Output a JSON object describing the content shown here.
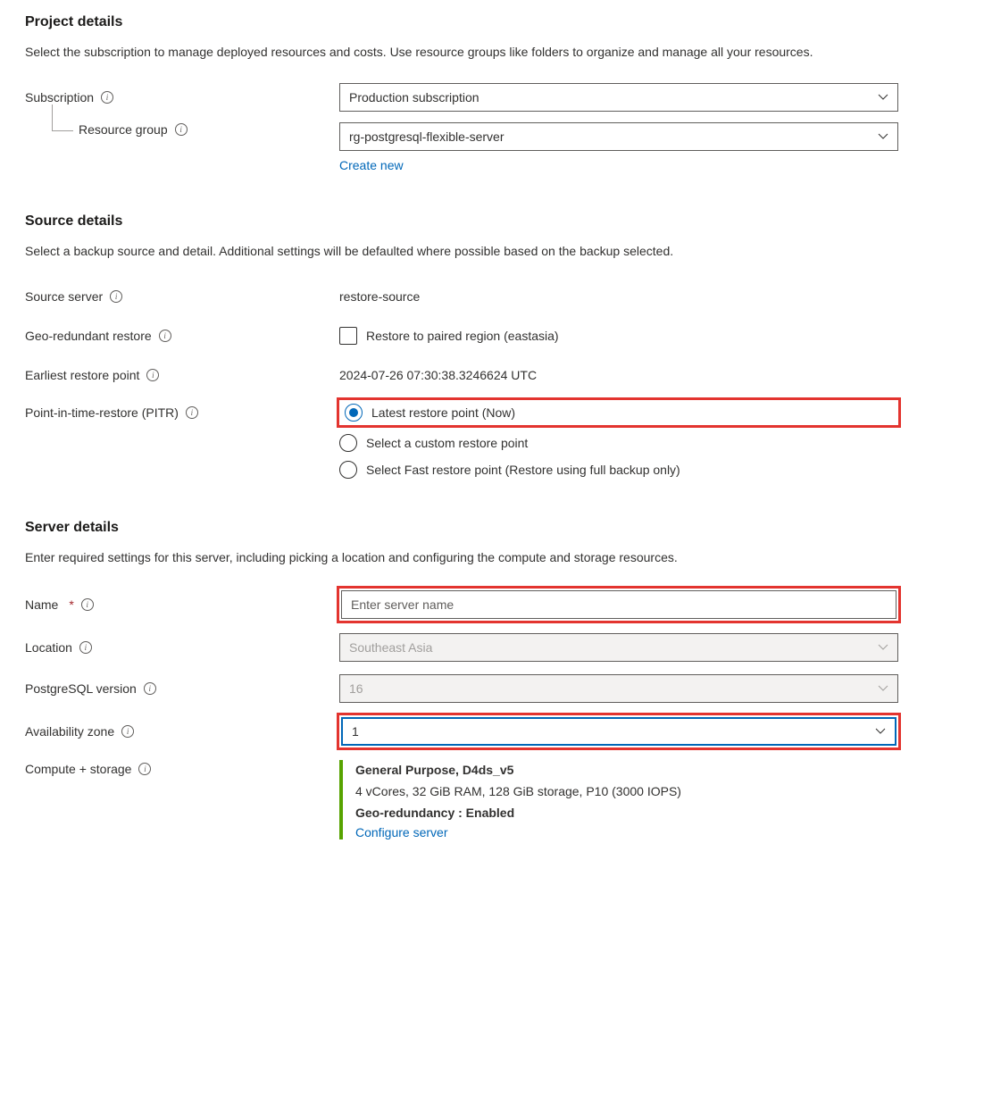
{
  "project": {
    "heading": "Project details",
    "desc": "Select the subscription to manage deployed resources and costs. Use resource groups like folders to organize and manage all your resources.",
    "subscription_label": "Subscription",
    "subscription_value": "Production subscription",
    "resource_group_label": "Resource group",
    "resource_group_value": "rg-postgresql-flexible-server",
    "create_new": "Create new"
  },
  "source": {
    "heading": "Source details",
    "desc": "Select a backup source and detail. Additional settings will be defaulted where possible based on the backup selected.",
    "source_server_label": "Source server",
    "source_server_value": "restore-source",
    "geo_label": "Geo-redundant restore",
    "geo_checkbox_label": "Restore to paired region (eastasia)",
    "earliest_label": "Earliest restore point",
    "earliest_value": "2024-07-26 07:30:38.3246624 UTC",
    "pitr_label": "Point-in-time-restore (PITR)",
    "pitr_options": {
      "latest": "Latest restore point (Now)",
      "custom": "Select a custom restore point",
      "fast": "Select Fast restore point (Restore using full backup only)"
    }
  },
  "server": {
    "heading": "Server details",
    "desc": "Enter required settings for this server, including picking a location and configuring the compute and storage resources.",
    "name_label": "Name",
    "name_placeholder": "Enter server name",
    "location_label": "Location",
    "location_value": "Southeast Asia",
    "version_label": "PostgreSQL version",
    "version_value": "16",
    "az_label": "Availability zone",
    "az_value": "1",
    "compute_label": "Compute + storage",
    "compute_tier": "General Purpose, D4ds_v5",
    "compute_specs": "4 vCores, 32 GiB RAM, 128 GiB storage, P10 (3000 IOPS)",
    "compute_geo": "Geo-redundancy : Enabled",
    "configure_link": "Configure server"
  }
}
